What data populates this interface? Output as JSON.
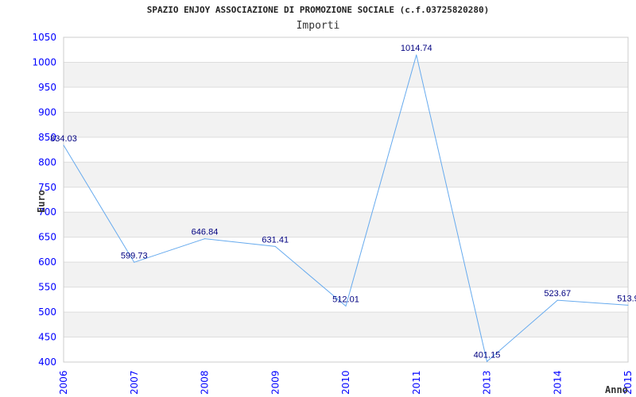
{
  "chart_data": {
    "type": "line",
    "title": "SPAZIO ENJOY ASSOCIAZIONE DI PROMOZIONE SOCIALE (c.f.03725820280)",
    "subtitle": "Importi",
    "xlabel": "Anno",
    "ylabel": "Euro",
    "categories": [
      "2006",
      "2007",
      "2008",
      "2009",
      "2010",
      "2011",
      "2013",
      "2014",
      "2015"
    ],
    "values": [
      834.03,
      599.73,
      646.84,
      631.41,
      512.01,
      1014.74,
      401.15,
      523.67,
      513.9
    ],
    "data_labels": [
      "834.03",
      "599.73",
      "646.84",
      "631.41",
      "512.01",
      "1014.74",
      "401.15",
      "523.67",
      "513.9"
    ],
    "ylim": [
      400,
      1050
    ],
    "yticks": [
      "400",
      "450",
      "500",
      "550",
      "600",
      "650",
      "700",
      "750",
      "800",
      "850",
      "900",
      "950",
      "1000",
      "1050"
    ],
    "grid": true,
    "colors": {
      "line": "#66aaee",
      "tick_labels": "#0000ff",
      "data_labels": "#000080",
      "band": "#f2f2f2",
      "grid": "#dddddd"
    }
  }
}
